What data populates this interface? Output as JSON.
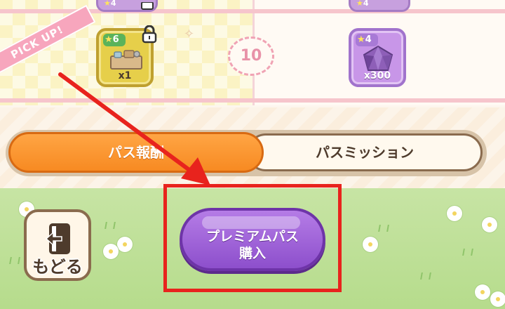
{
  "rewards": {
    "pickup_label": "PICK UP!",
    "level": "10",
    "free_item": {
      "name": "toolbox",
      "star_level": "6",
      "quantity": "x1",
      "locked": true
    },
    "premium_item": {
      "name": "purple-crystal",
      "star_level": "4",
      "quantity": "x300"
    },
    "peek_row": {
      "left_star_level": "4",
      "right_star_level": "4"
    }
  },
  "tabs": [
    {
      "label": "パス報酬",
      "selected": true
    },
    {
      "label": "パスミッション",
      "selected": false
    }
  ],
  "back_button": {
    "label": "もどる",
    "icon": "exit-door-icon"
  },
  "premium_button": {
    "line1": "プレミアムパス",
    "line2": "購入"
  },
  "annotation": {
    "color": "#e8231d"
  },
  "colors": {
    "tab_active": "#f78a22",
    "premium": "#8d4fcc",
    "grass": "#b6dc8c"
  }
}
